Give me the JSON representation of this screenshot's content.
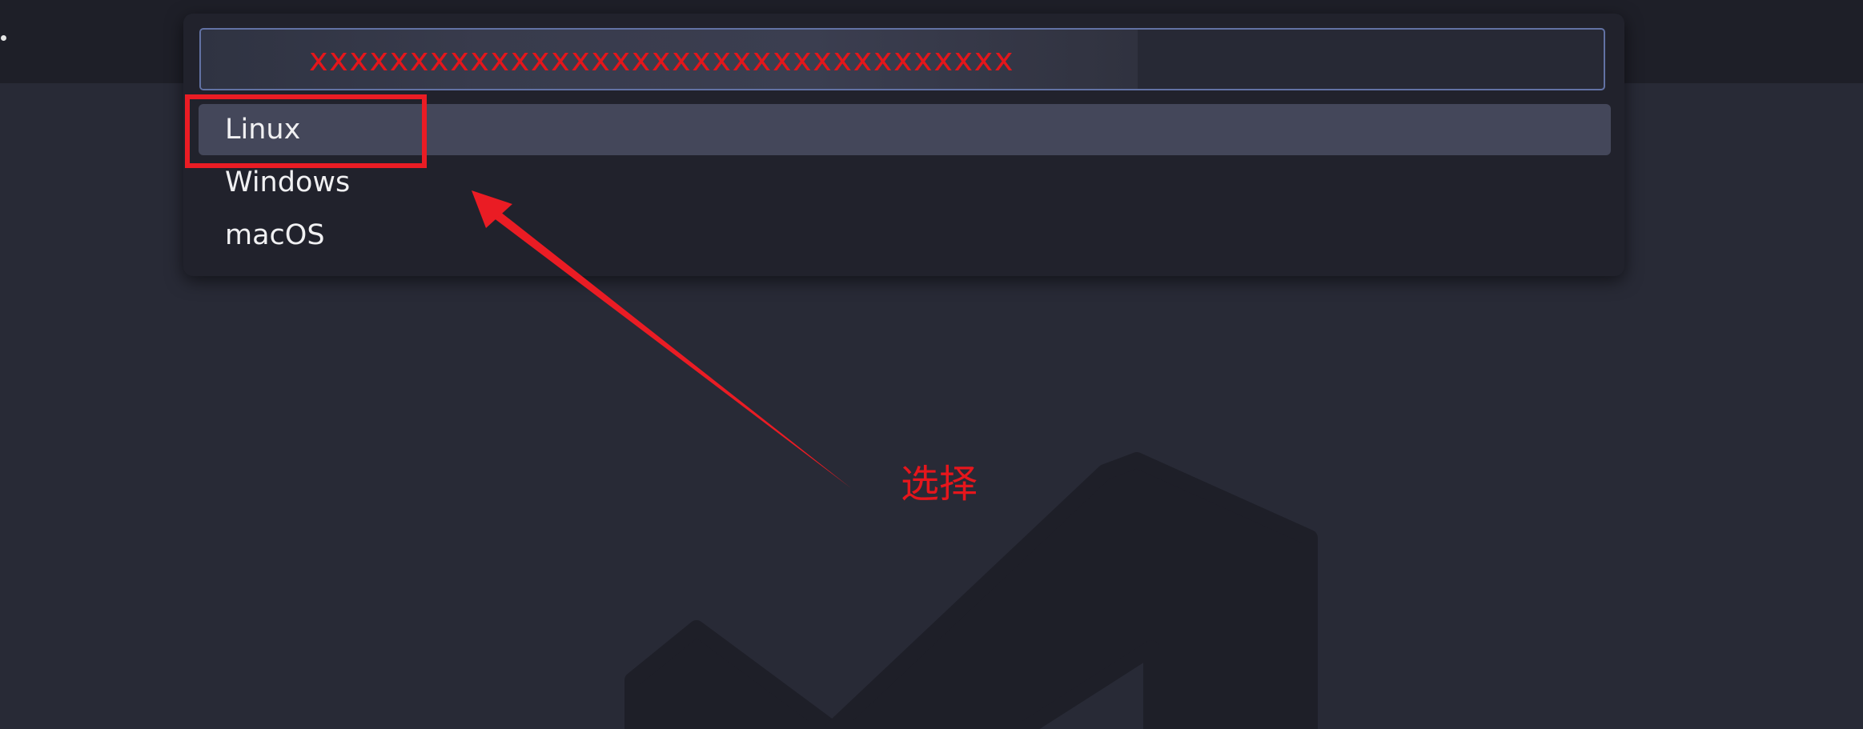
{
  "window": {
    "title_char": "."
  },
  "quick_pick": {
    "input": {
      "value": "xxxxxxxxxxxxxxxxxxxxxxxxxxxxxxxxxxx",
      "border_color": "#6272a4"
    },
    "items": [
      {
        "label": "Linux",
        "selected": true
      },
      {
        "label": "Windows",
        "selected": false
      },
      {
        "label": "macOS",
        "selected": false
      }
    ]
  },
  "annotation": {
    "label": "选择",
    "color": "#ea1c24",
    "highlight_target": "Linux"
  },
  "icons": {
    "watermark": "vscode-logo-icon",
    "arrow": "red-arrow-icon"
  },
  "colors": {
    "background": "#282a36",
    "titlebar": "#1e1f28",
    "panel": "#21222c",
    "selected_item": "#44475a"
  }
}
